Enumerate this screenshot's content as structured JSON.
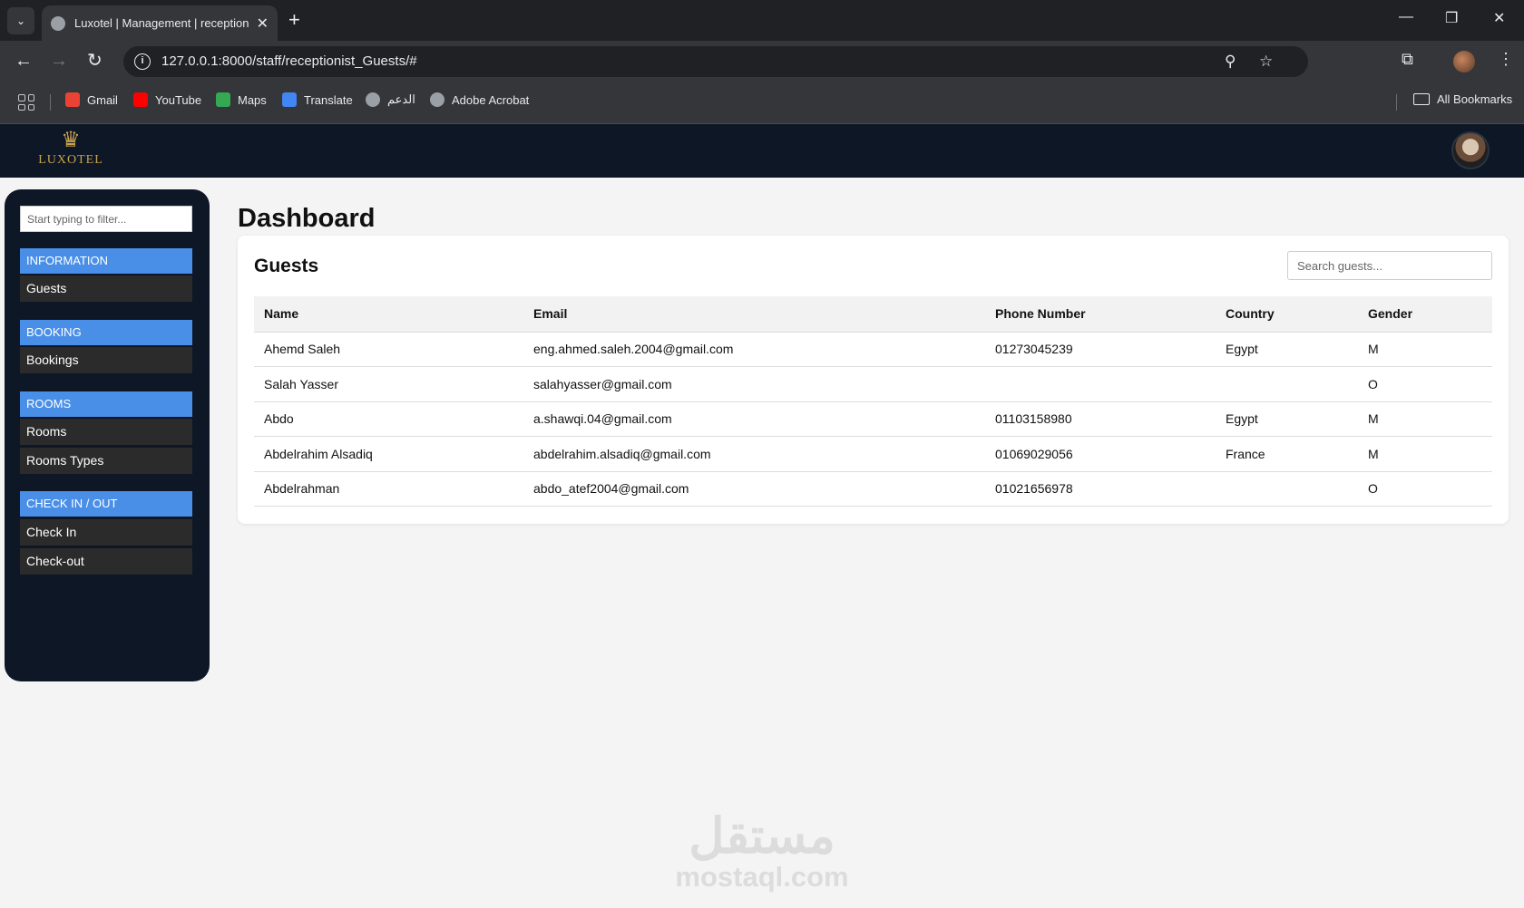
{
  "browser": {
    "tab_title": "Luxotel | Management | receptionist",
    "tab_close": "✕",
    "new_tab": "+",
    "tab_search": "⌄",
    "window": {
      "minimize": "—",
      "restore": "❐",
      "close": "✕"
    },
    "nav": {
      "back": "←",
      "forward": "→",
      "reload": "↻"
    },
    "url": "127.0.0.1:8000/staff/receptionist_Guests/#",
    "info_icon": "i",
    "icons": {
      "zoom": "⚲",
      "star": "☆",
      "extensions": "⧉",
      "menu": "⋮"
    },
    "bookmarks": [
      {
        "label": "Gmail",
        "icon": "gmail-icon",
        "color": "#ea4335"
      },
      {
        "label": "YouTube",
        "icon": "youtube-icon",
        "color": "#ff0000"
      },
      {
        "label": "Maps",
        "icon": "maps-icon",
        "color": "#34a853"
      },
      {
        "label": "Translate",
        "icon": "translate-icon",
        "color": "#4285f4"
      },
      {
        "label": "الدعم",
        "icon": "globe-icon",
        "color": "#9aa0a6"
      },
      {
        "label": "Adobe Acrobat",
        "icon": "globe-icon",
        "color": "#9aa0a6"
      }
    ],
    "all_bookmarks": "All Bookmarks"
  },
  "header": {
    "logo_text": "LUXOTEL",
    "logo_mark": "♛",
    "brand_color": "#c9a24b"
  },
  "sidebar": {
    "filter_placeholder": "Start typing to filter...",
    "sections": [
      {
        "category": "INFORMATION",
        "links": [
          "Guests"
        ]
      },
      {
        "category": "BOOKING",
        "links": [
          "Bookings"
        ]
      },
      {
        "category": "ROOMS",
        "links": [
          "Rooms",
          "Rooms Types"
        ]
      },
      {
        "category": "CHECK IN / OUT",
        "links": [
          "Check In",
          "Check-out"
        ]
      }
    ],
    "accent_color": "#4a8fe7"
  },
  "main": {
    "page_title": "Dashboard",
    "card_title": "Guests",
    "search_placeholder": "Search guests...",
    "columns": [
      "Name",
      "Email",
      "Phone Number",
      "Country",
      "Gender"
    ],
    "rows": [
      [
        "Ahemd Saleh",
        "eng.ahmed.saleh.2004@gmail.com",
        "01273045239",
        "Egypt",
        "M"
      ],
      [
        "Salah Yasser",
        "salahyasser@gmail.com",
        "",
        "",
        "O"
      ],
      [
        "Abdo",
        "a.shawqi.04@gmail.com",
        "01103158980",
        "Egypt",
        "M"
      ],
      [
        "Abdelrahim Alsadiq",
        "abdelrahim.alsadiq@gmail.com",
        "01069029056",
        "France",
        "M"
      ],
      [
        "Abdelrahman",
        "abdo_atef2004@gmail.com",
        "01021656978",
        "",
        "O"
      ]
    ]
  },
  "watermark": {
    "arabic": "مستقل",
    "latin": "mostaql.com"
  }
}
